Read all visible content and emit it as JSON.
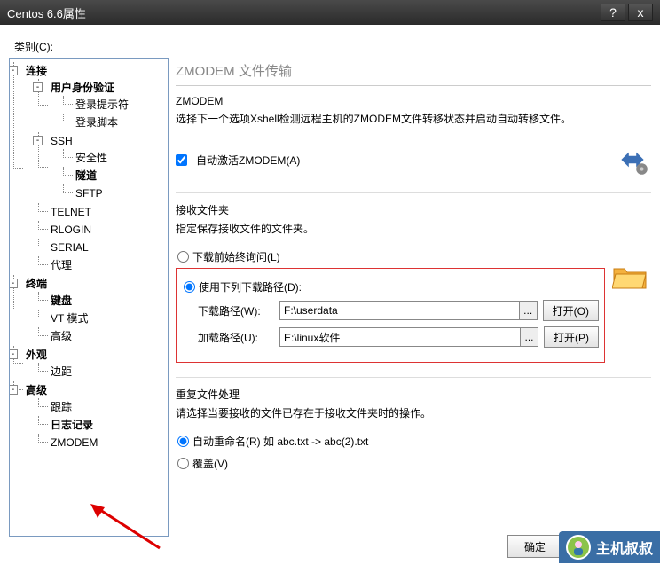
{
  "window": {
    "title": "Centos 6.6属性",
    "help": "?",
    "close": "x"
  },
  "category_label": "类别(C):",
  "tree": {
    "connect": "连接",
    "userauth": "用户身份验证",
    "loginprompt": "登录提示符",
    "loginscript": "登录脚本",
    "ssh": "SSH",
    "security": "安全性",
    "tunnel": "隧道",
    "sftp": "SFTP",
    "telnet": "TELNET",
    "rlogin": "RLOGIN",
    "serial": "SERIAL",
    "proxy": "代理",
    "terminal": "终端",
    "keyboard": "键盘",
    "vtmode": "VT 模式",
    "advanced_t": "高级",
    "appearance": "外观",
    "margin": "边距",
    "advanced": "高级",
    "trace": "跟踪",
    "log": "日志记录",
    "zmodem": "ZMODEM"
  },
  "panel": {
    "header": "ZMODEM 文件传输",
    "zmodem_title": "ZMODEM",
    "zmodem_desc": "选择下一个选项Xshell检测远程主机的ZMODEM文件转移状态并启动自动转移文件。",
    "auto_activate": "自动激活ZMODEM(A)",
    "recv_title": "接收文件夹",
    "recv_desc": "指定保存接收文件的文件夹。",
    "radio_ask": "下载前始终询问(L)",
    "radio_path": "使用下列下载路径(D):",
    "dl_label": "下载路径(W):",
    "dl_value": "F:\\userdata",
    "up_label": "加载路径(U):",
    "up_value": "E:\\linux软件",
    "dots": "...",
    "open_w": "打开(O)",
    "open_u": "打开(P)",
    "dup_title": "重复文件处理",
    "dup_desc": "请选择当要接收的文件已存在于接收文件夹时的操作。",
    "auto_rename": "自动重命名(R) 如 abc.txt -> abc(2).txt",
    "overwrite": "覆盖(V)"
  },
  "buttons": {
    "ok": "确定"
  },
  "brand": "主机叔叔"
}
